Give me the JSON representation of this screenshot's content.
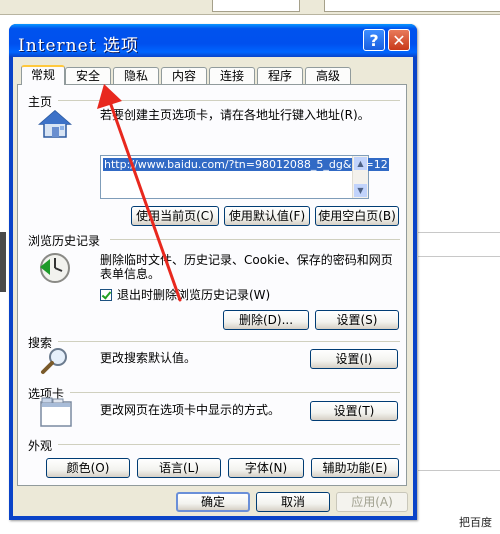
{
  "window": {
    "title": "Internet 选项",
    "help_glyph": "?",
    "close_glyph": "✕"
  },
  "tabs": [
    "常规",
    "安全",
    "隐私",
    "内容",
    "连接",
    "程序",
    "高级"
  ],
  "home": {
    "group_label": "主页",
    "desc": "若要创建主页选项卡，请在各地址行键入地址(R)。",
    "url": "http://www.baidu.com/?tn=98012088_5_dg&ch=12",
    "btn_current": "使用当前页(C)",
    "btn_default": "使用默认值(F)",
    "btn_blank": "使用空白页(B)"
  },
  "history": {
    "group_label": "浏览历史记录",
    "desc_line1": "删除临时文件、历史记录、Cookie、保存的密码和网页",
    "desc_line2": "表单信息。",
    "checkbox_label": "退出时删除浏览历史记录(W)",
    "checkbox_checked": true,
    "btn_delete": "删除(D)...",
    "btn_settings": "设置(S)"
  },
  "search": {
    "group_label": "搜索",
    "desc": "更改搜索默认值。",
    "btn_settings": "设置(I)"
  },
  "tabbed": {
    "group_label": "选项卡",
    "desc": "更改网页在选项卡中显示的方式。",
    "btn_settings": "设置(T)"
  },
  "appearance": {
    "group_label": "外观",
    "btn_colors": "颜色(O)",
    "btn_languages": "语言(L)",
    "btn_fonts": "字体(N)",
    "btn_accessibility": "辅助功能(E)"
  },
  "footer": {
    "btn_ok": "确定",
    "btn_cancel": "取消",
    "btn_apply": "应用(A)"
  },
  "background": {
    "caption": "把百度"
  },
  "colors": {
    "titlebar": "#0053ee",
    "annotation_arrow": "#e8281e",
    "panel": "#fcfcfe"
  }
}
